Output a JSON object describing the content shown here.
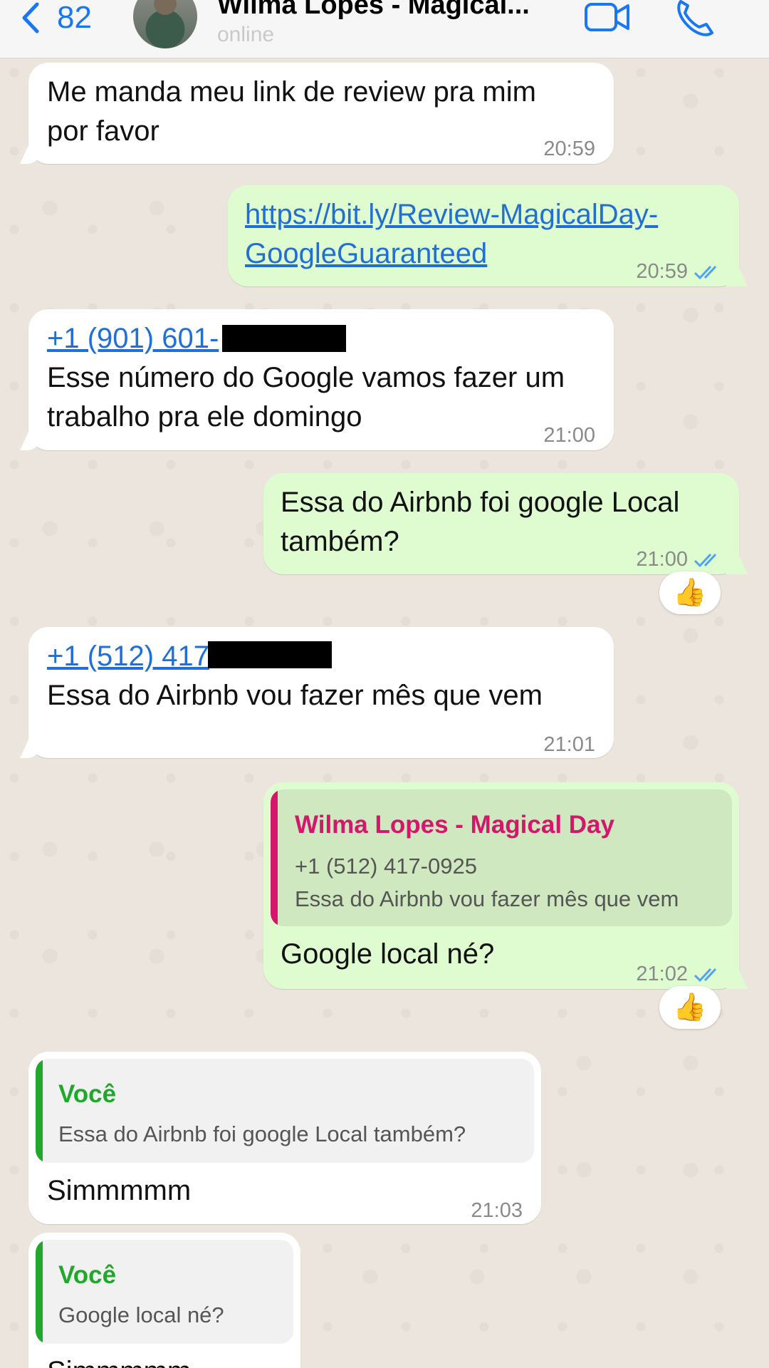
{
  "header": {
    "back_count": "82",
    "contact_name": "Wilma Lopes - Magical...",
    "status": "online"
  },
  "messages": [
    {
      "lines": [
        "Me manda meu link de review pra mim",
        "por favor"
      ],
      "time": "20:59"
    },
    {
      "lines": [
        "https://bit.ly/Review-MagicalDay-",
        "GoogleGuaranteed"
      ],
      "time": "20:59"
    },
    {
      "phone": "+1 (901) 601-",
      "lines": [
        "Esse número do Google vamos fazer um",
        "trabalho pra ele domingo"
      ],
      "time": "21:00"
    },
    {
      "lines": [
        "Essa do Airbnb foi google Local",
        "também?"
      ],
      "time": "21:00",
      "reaction": "👍"
    },
    {
      "phone": "+1 (512) 417",
      "lines": [
        "Essa do Airbnb vou fazer mês que vem"
      ],
      "time": "21:01"
    },
    {
      "quote": {
        "author": "Wilma Lopes - Magical Day",
        "line1": "+1 (512) 417-0925",
        "line2": "Essa do Airbnb vou fazer mês que vem"
      },
      "lines": [
        "Google local né?"
      ],
      "time": "21:02",
      "reaction": "👍"
    },
    {
      "quote": {
        "author": "Você",
        "line1": "Essa do Airbnb foi google Local também?"
      },
      "lines": [
        "Simmmmm"
      ],
      "time": "21:03"
    },
    {
      "quote": {
        "author": "Você",
        "line1": "Google local né?"
      },
      "lines": [
        "Simmmmm"
      ]
    }
  ],
  "colors": {
    "link": "#1f6fd6",
    "outgoing_bubble": "#dffbd0",
    "incoming_bubble": "#ffffff",
    "quote_wilma": "#d6156c",
    "quote_you": "#1fa82a",
    "read_ticks": "#4fa3f7"
  }
}
